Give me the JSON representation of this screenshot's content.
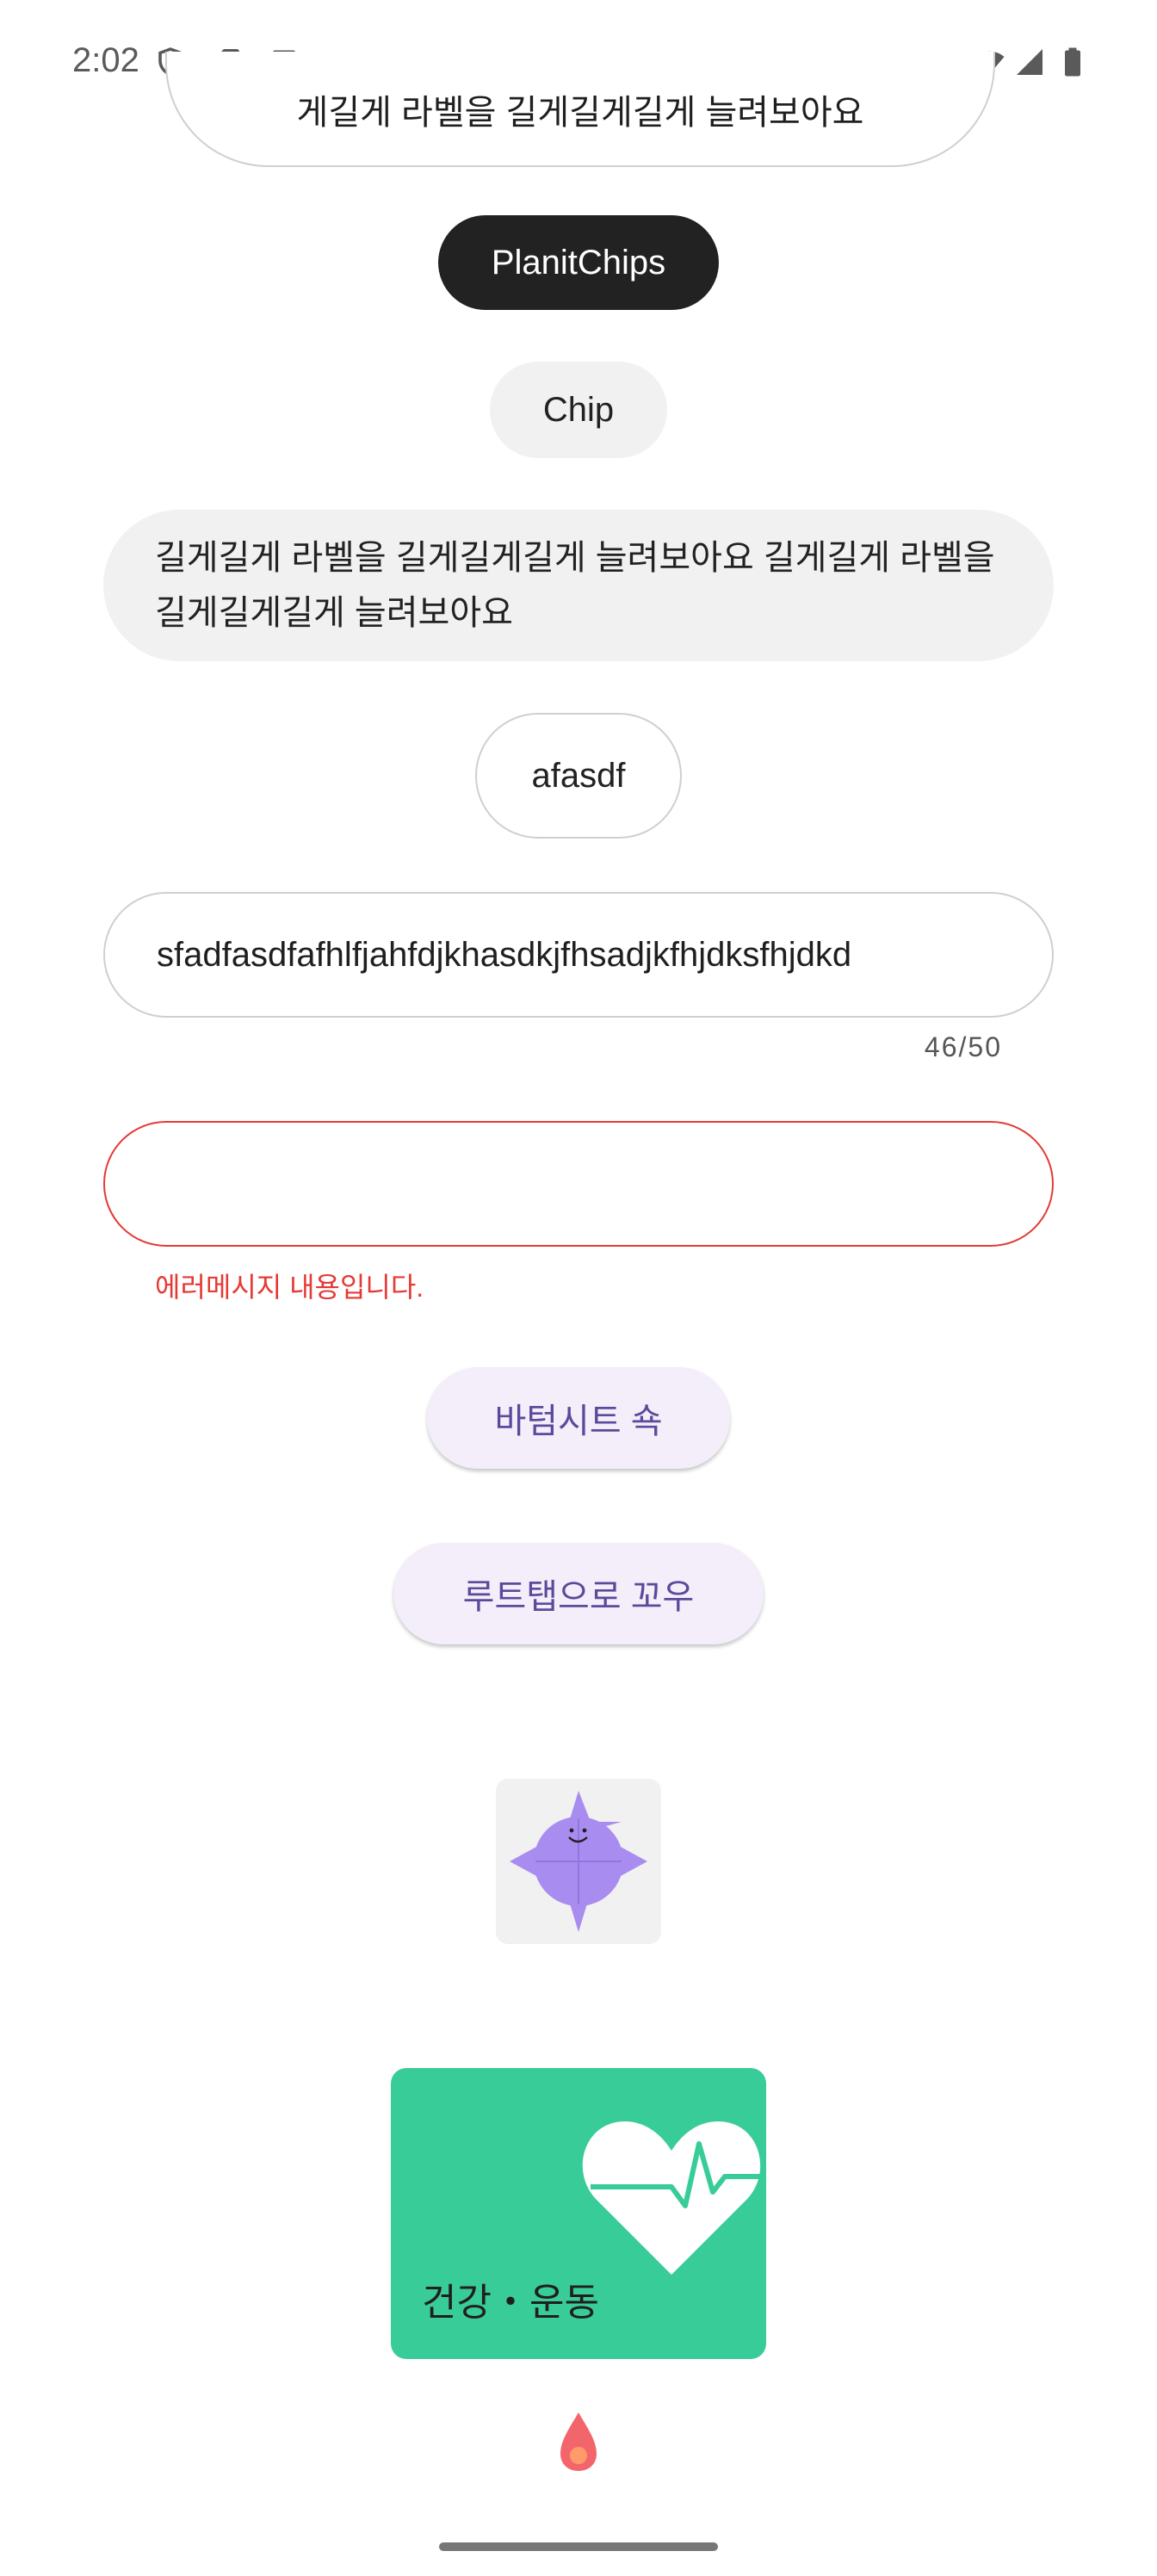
{
  "status_bar": {
    "time": "2:02",
    "icons": [
      "shield-icon",
      "sd-card-icon",
      "font-a-icon",
      "wifi-icon",
      "signal-icon",
      "battery-icon"
    ]
  },
  "chips": {
    "cut_label": "게길게 라벨을 길게길게길게 늘려보아요",
    "planit_label": "PlanitChips",
    "chip_label": "Chip",
    "multiline_label": "길게길게 라벨을 길게길게길게 늘려보아요 길게길게 라벨을 길게길게길게 늘려보아요",
    "outline_label": "afasdf"
  },
  "text_field": {
    "value": "sfadfasdfafhlfjahfdjkhasdkjfhsadjkfhjdksfhjdkd",
    "counter": "46/50"
  },
  "error_field": {
    "value": "",
    "error_message": "에러메시지 내용입니다."
  },
  "buttons": {
    "bottom_sheet": "바텀시트 쇽",
    "route_tab": "루트탭으로 꼬우"
  },
  "category_card": {
    "label": "건강・운동",
    "color": "#38cc98"
  },
  "colors": {
    "accent_purple": "#5b4a9b",
    "error": "#e53935",
    "chip_dark": "#222222"
  }
}
